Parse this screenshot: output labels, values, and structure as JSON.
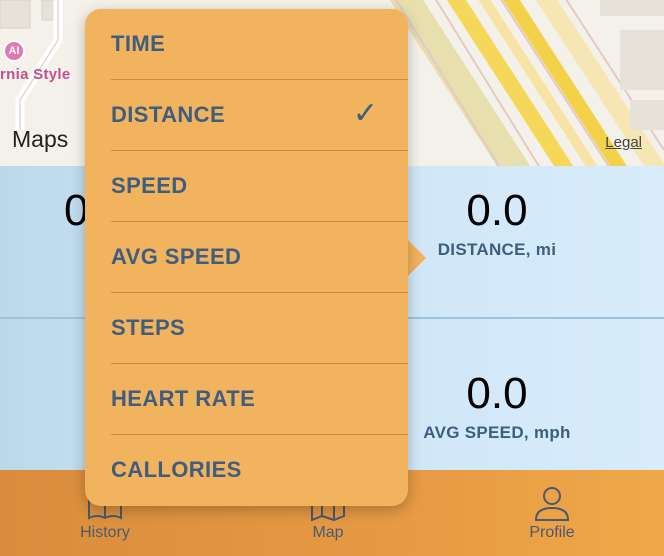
{
  "map": {
    "poi_glyph": "AI",
    "poi_label": "rnia Style",
    "brand": "Maps",
    "legal": "Legal"
  },
  "stats": {
    "left_value": "0",
    "distance_value": "0.0",
    "distance_label": "DISTANCE, mi",
    "avg_speed_value": "0.0",
    "avg_speed_label": "AVG SPEED, mph"
  },
  "menu": {
    "items": [
      {
        "label": "TIME",
        "selected": false
      },
      {
        "label": "DISTANCE",
        "selected": true
      },
      {
        "label": "SPEED",
        "selected": false
      },
      {
        "label": "AVG SPEED",
        "selected": false
      },
      {
        "label": "STEPS",
        "selected": false
      },
      {
        "label": "HEART RATE",
        "selected": false
      },
      {
        "label": "CALLORIES",
        "selected": false
      }
    ],
    "check_glyph": "✓"
  },
  "tabbar": {
    "history": "History",
    "map": "Map",
    "profile": "Profile"
  },
  "colors": {
    "popover": "#f2b35e",
    "menu_text": "#3f5d7f",
    "tabbar": "#e69a44",
    "stats_bg": "#cfe6f7"
  }
}
